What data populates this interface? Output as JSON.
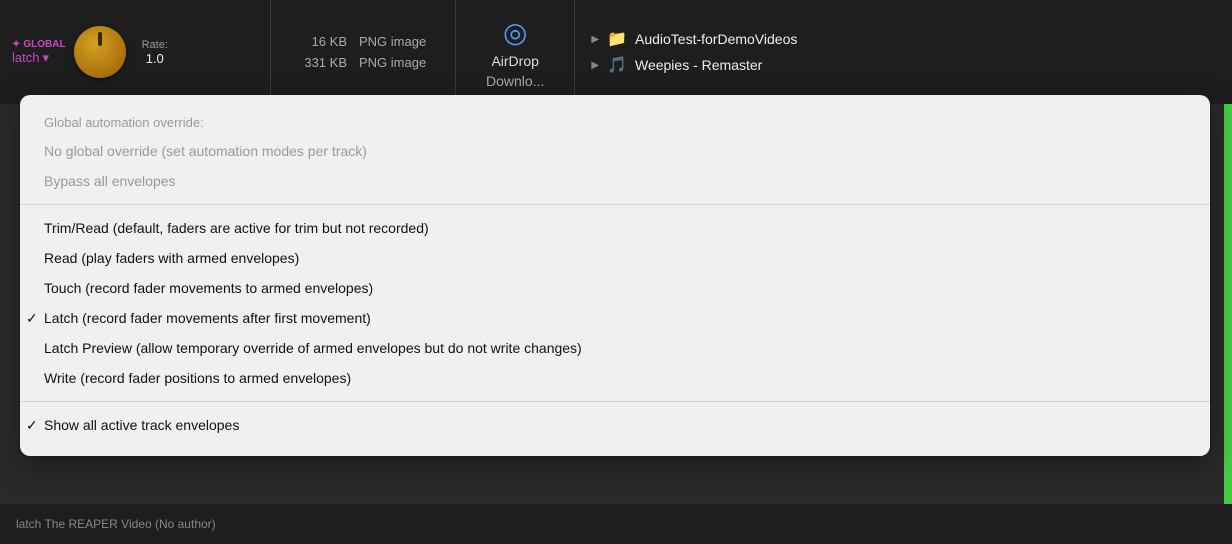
{
  "topbar": {
    "global_label": "GLOBAL",
    "latch_label": "latch",
    "dropdown_arrow": "▾",
    "rate_label": "Rate:",
    "rate_value": "1.0",
    "files": [
      {
        "size": "16 KB",
        "type": "PNG image"
      },
      {
        "size": "331 KB",
        "type": "PNG image"
      }
    ],
    "airdrop_label": "AirDrop",
    "download_partial": "Downlo...",
    "folders": [
      {
        "name": "AudioTest-forDemoVideos",
        "icon": "📁",
        "color": "#5599ff"
      },
      {
        "name": "Weepies - Remaster",
        "icon": "🎵",
        "color": "#44aadd"
      }
    ]
  },
  "menu": {
    "section_label": "Global automation override:",
    "items_section1": [
      {
        "label": "No global override (set automation modes per track)",
        "checked": false
      },
      {
        "label": "Bypass all envelopes",
        "checked": false
      }
    ],
    "items_section2": [
      {
        "label": "Trim/Read (default, faders are active for trim but not recorded)",
        "checked": false
      },
      {
        "label": "Read (play faders with armed envelopes)",
        "checked": false
      },
      {
        "label": "Touch (record fader movements to armed envelopes)",
        "checked": false
      },
      {
        "label": "Latch (record fader movements after first movement)",
        "checked": true
      },
      {
        "label": "Latch Preview (allow temporary override of armed envelopes but do not write changes)",
        "checked": false
      },
      {
        "label": "Write (record fader positions to armed envelopes)",
        "checked": false
      }
    ],
    "items_section3": [
      {
        "label": "Show all active track envelopes",
        "checked": true
      }
    ]
  },
  "bottom": {
    "text": "latch  The REAPER Video (No author)"
  }
}
